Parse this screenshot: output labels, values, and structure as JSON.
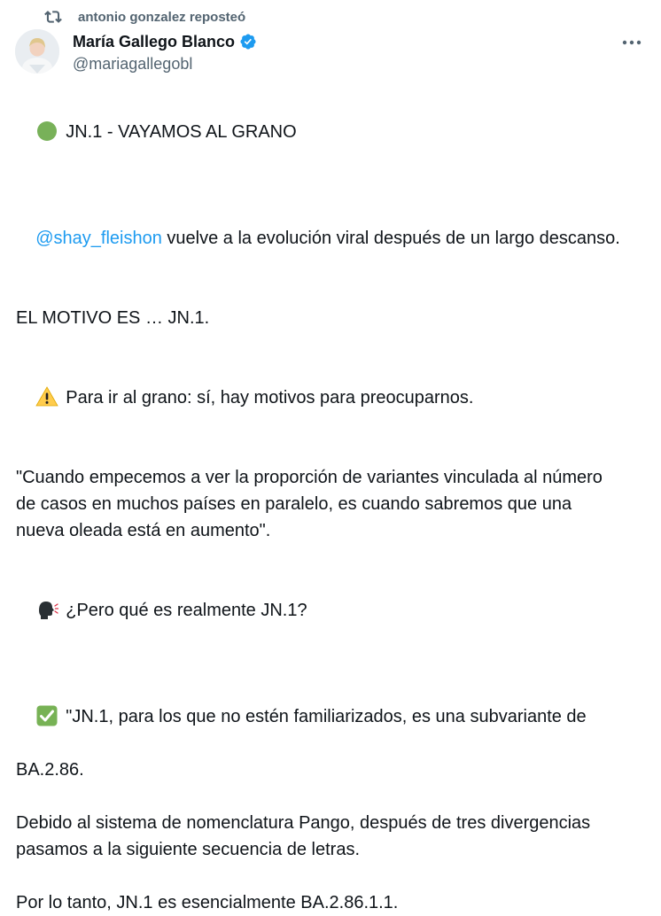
{
  "repost": {
    "icon": "repost-icon",
    "text": "antonio gonzalez reposteó"
  },
  "author": {
    "name": "María Gallego Blanco",
    "handle": "@mariagallegobl",
    "verified_icon": "verified-badge-icon",
    "avatar": "avatar"
  },
  "menu": {
    "more_icon": "more-options-icon"
  },
  "tweet": {
    "line1": "JN.1 - VAYAMOS AL GRANO",
    "mention": "@shay_fleishon",
    "line2_rest": " vuelve a la evolución viral después de un largo descanso.",
    "line3": "EL MOTIVO ES … JN.1.",
    "line4": "Para ir al grano: sí, hay motivos para preocuparnos.",
    "quote_line1": "\"Cuando empecemos a ver la proporción de variantes vinculada al número",
    "quote_line2": "de casos en muchos países en paralelo, es cuando sabremos que una",
    "quote_line3": "nueva oleada está en aumento\".",
    "line5": "¿Pero qué es realmente JN.1?",
    "line6a": "\"JN.1, para los que no estén familiarizados, es una subvariante de",
    "line6b": "BA.2.86.",
    "line7a": "Debido al sistema de nomenclatura Pango, después de tres divergencias",
    "line7b": "pasamos a la siguiente secuencia de letras.",
    "line8": "Por lo tanto, JN.1 es esencialmente BA.2.86.1.1."
  },
  "colors": {
    "text": "#0f1419",
    "muted": "#536471",
    "link": "#1d9bf0",
    "green_circle": "#78b159",
    "warning_yellow": "#ffcc4d",
    "check_green": "#77b255",
    "speaking_head": "#292f33"
  }
}
